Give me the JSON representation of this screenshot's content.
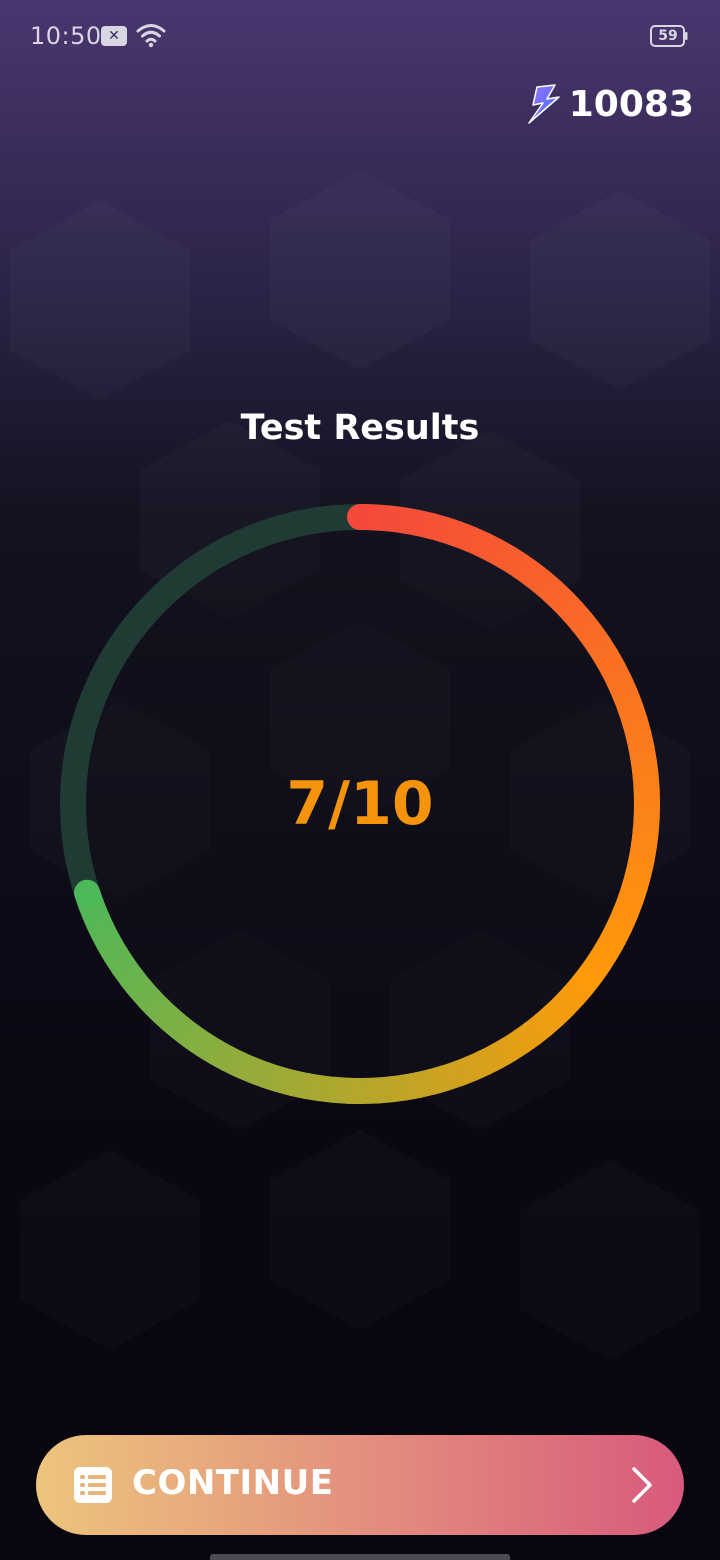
{
  "status_bar": {
    "time": "10:50",
    "notification_icon": "close-x-icon",
    "wifi_icon": "wifi-icon",
    "battery_level": "59"
  },
  "coins": {
    "icon": "lightning-bolt-icon",
    "count": "10083"
  },
  "results": {
    "title": "Test Results",
    "score_text": "7/10",
    "score": 7,
    "total": 10
  },
  "continue_button": {
    "label": "CONTINUE",
    "left_icon": "list-icon",
    "right_icon": "chevron-right-icon"
  },
  "colors": {
    "score_text": "#f5940c",
    "ring_track": "#203a34",
    "ring_start": "#f54a3a",
    "ring_mid": "#ff9a0a",
    "ring_end": "#4cb85a",
    "button_start": "#ecc57c",
    "button_end": "#d85a7c"
  }
}
